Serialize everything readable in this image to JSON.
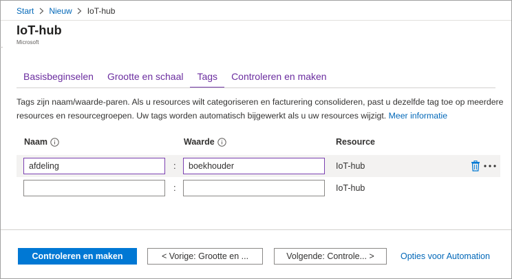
{
  "breadcrumb": {
    "items": [
      "Start",
      "Nieuw",
      "IoT-hub"
    ]
  },
  "header": {
    "title": "IoT-hub",
    "publisher": "Microsoft"
  },
  "tabs": [
    {
      "label": "Basisbeginselen",
      "active": false
    },
    {
      "label": "Grootte en schaal",
      "active": false
    },
    {
      "label": "Tags",
      "active": true
    },
    {
      "label": "Controleren en maken",
      "active": false
    }
  ],
  "description": {
    "text": "Tags zijn naam/waarde-paren. Als u resources wilt categoriseren en facturering consolideren, past u dezelfde tag toe op meerdere resources en resourcegroepen. Uw tags worden automatisch bijgewerkt als u uw resources wijzigt.",
    "link": "Meer informatie"
  },
  "table": {
    "headers": {
      "name": "Naam",
      "value": "Waarde",
      "resource": "Resource"
    },
    "separator": ":",
    "rows": [
      {
        "name": "afdeling",
        "value": "boekhouder",
        "resource": "IoT-hub"
      },
      {
        "name": "",
        "value": "",
        "resource": "IoT-hub"
      }
    ]
  },
  "footer": {
    "primary": "Controleren en maken",
    "previous": "< Vorige: Grootte en ...",
    "next": "Volgende: Controle... >",
    "automation": "Opties voor Automation"
  },
  "colors": {
    "accent": "#0078d4",
    "link": "#0067b8",
    "tab": "#6b2d9f",
    "delete": "#0078d4"
  },
  "icons": {
    "breadcrumb_separator": "chevron-right-icon",
    "info": "info-icon",
    "delete": "trash-icon",
    "more": "more-icon"
  }
}
